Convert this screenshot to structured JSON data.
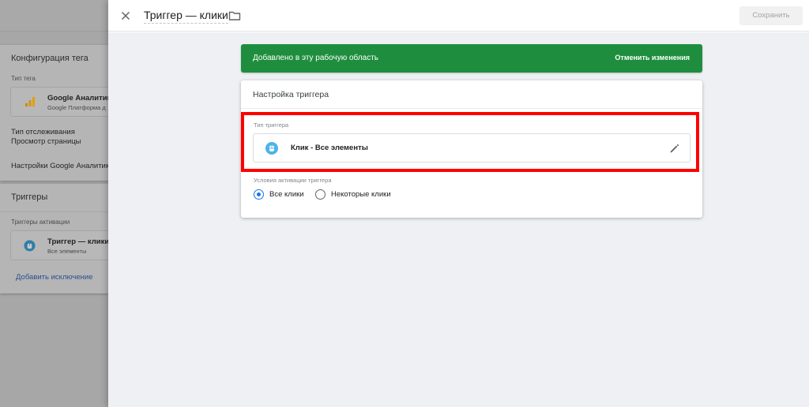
{
  "background": {
    "tag_config": {
      "title": "Конфигурация тега",
      "tag_type_label": "Тип тега",
      "tag_type_name": "Google Аналитика",
      "tag_type_sub": "Google Платформа д",
      "tracking_type_label": "Тип отслеживания",
      "tracking_type_value": "Просмотр страницы",
      "settings_label": "Настройки Google Аналитик"
    },
    "triggers": {
      "title": "Триггеры",
      "activation_label": "Триггеры активации",
      "trigger_name": "Триггер — клики",
      "trigger_sub": "Все элементы",
      "add_exception": "Добавить исключение"
    }
  },
  "header": {
    "title": "Триггер — клики",
    "save_label": "Сохранить"
  },
  "banner": {
    "text": "Добавлено в эту рабочую область",
    "action": "Отменить изменения"
  },
  "trigger_config": {
    "title": "Настройка триггера",
    "type_label": "Тип триггера",
    "type_name": "Клик - Все элементы",
    "conditions_label": "Условия активации триггера",
    "options": [
      {
        "label": "Все клики",
        "selected": true
      },
      {
        "label": "Некоторые клики",
        "selected": false
      }
    ]
  },
  "colors": {
    "banner_green": "#1e8e3e",
    "highlight_red": "#ff0000",
    "accent_blue": "#1a73e8",
    "trigger_icon_blue": "#4fb3e8",
    "ga_orange": "#f9ab00"
  },
  "icons": {
    "close": "close-icon",
    "folder": "folder-icon",
    "trigger_type": "click-trigger-icon",
    "edit": "pencil-icon",
    "analytics": "analytics-bars-icon"
  }
}
